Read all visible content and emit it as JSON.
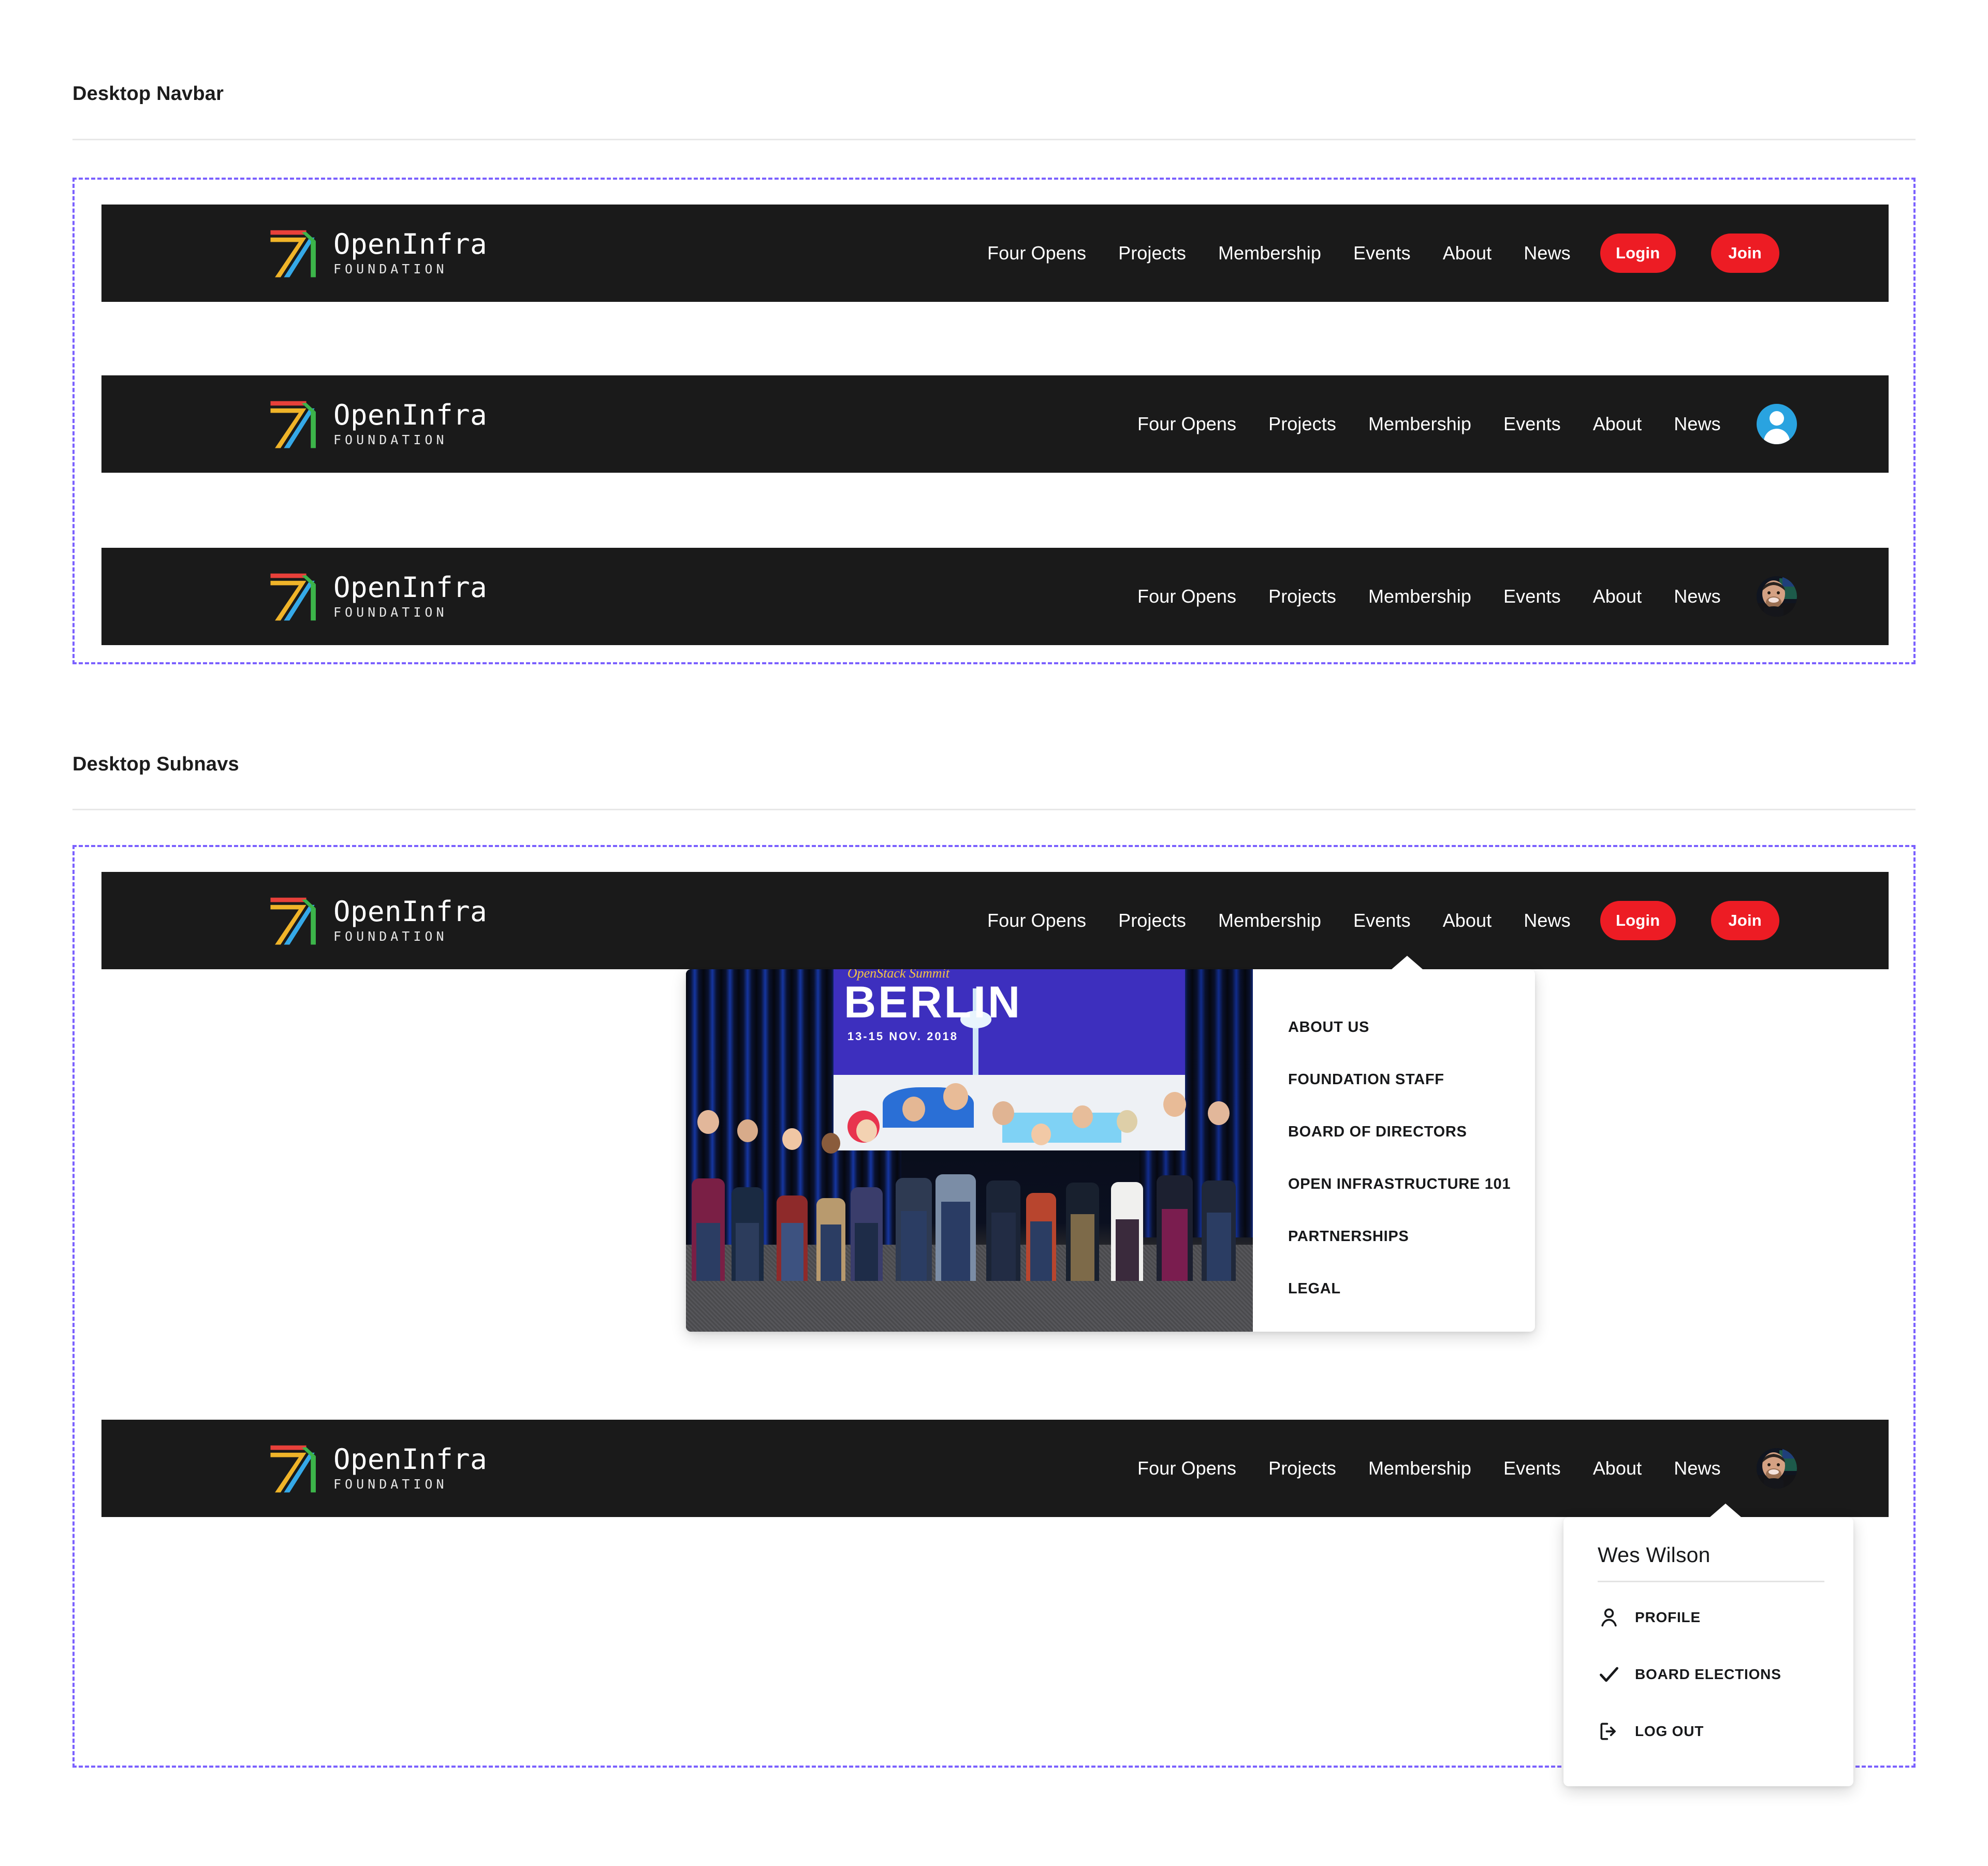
{
  "page": {
    "background": "#ffffff",
    "accent_purple": "#7b61ff",
    "brand_red": "#ed1c24",
    "navbar_bg": "#1a1a1a"
  },
  "sections": [
    {
      "title": "Desktop Navbar"
    },
    {
      "title": "Desktop Subnavs"
    }
  ],
  "logo": {
    "name": "OpenInfra",
    "subtitle": "FOUNDATION",
    "icon": "openinfra-logo-mark",
    "colors": {
      "red": "#e8403a",
      "yellow": "#f0b429",
      "blue": "#35a9e8",
      "green": "#3cb54a"
    }
  },
  "nav": {
    "items": [
      "Four Opens",
      "Projects",
      "Membership",
      "Events",
      "About",
      "News"
    ],
    "login_label": "Login",
    "join_label": "Join"
  },
  "navbars": [
    {
      "variant": "logged-out",
      "items": [
        "Four Opens",
        "Projects",
        "Membership",
        "Events",
        "About",
        "News"
      ],
      "login_label": "Login",
      "join_label": "Join",
      "avatar": null
    },
    {
      "variant": "logged-in-default-avatar",
      "items": [
        "Four Opens",
        "Projects",
        "Membership",
        "Events",
        "About",
        "News"
      ],
      "avatar": "default-user-avatar"
    },
    {
      "variant": "logged-in-photo-avatar",
      "items": [
        "Four Opens",
        "Projects",
        "Membership",
        "Events",
        "About",
        "News"
      ],
      "avatar": "user-photo-avatar"
    }
  ],
  "about_subnav": {
    "active_nav_item": "About",
    "login_label": "Login",
    "join_label": "Join",
    "image": {
      "alt": "OpenStack Summit Berlin group photo on stage",
      "banner_eyebrow": "OpenStack Summit",
      "banner_title": "BERLIN",
      "banner_date": "13-15 NOV. 2018"
    },
    "menu_items": [
      "ABOUT US",
      "FOUNDATION STAFF",
      "BOARD OF DIRECTORS",
      "OPEN INFRASTRUCTURE 101",
      "PARTNERSHIPS",
      "LEGAL"
    ]
  },
  "user_subnav": {
    "items": [
      "Four Opens",
      "Projects",
      "Membership",
      "Events",
      "About",
      "News"
    ],
    "avatar": "user-photo-avatar",
    "user_name": "Wes Wilson",
    "menu_items": [
      {
        "label": "PROFILE",
        "icon": "person-icon"
      },
      {
        "label": "BOARD ELECTIONS",
        "icon": "check-icon"
      },
      {
        "label": "LOG OUT",
        "icon": "logout-icon"
      }
    ]
  }
}
